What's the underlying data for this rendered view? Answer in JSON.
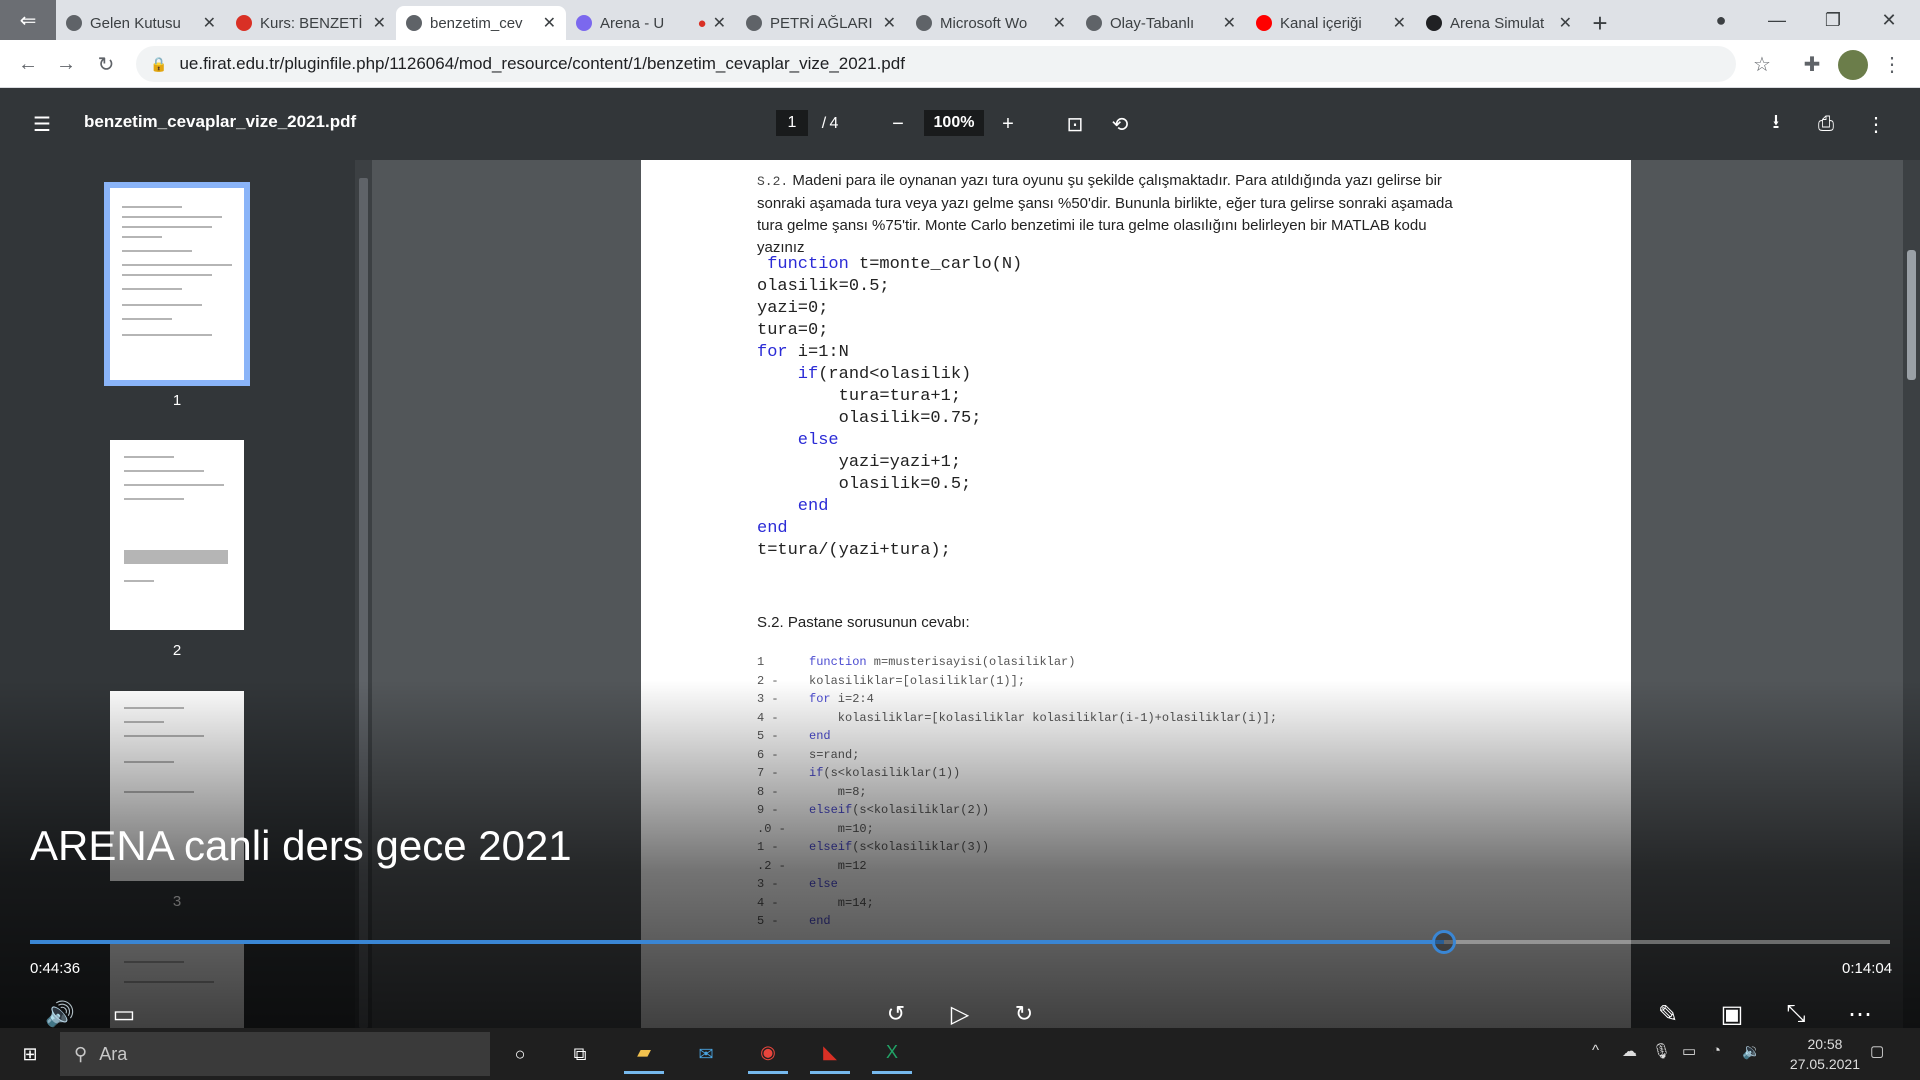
{
  "browser": {
    "tabs": [
      {
        "label": "Gelen Kutusu",
        "icon": "mail-icon",
        "color": "#5f6368"
      },
      {
        "label": "Kurs: BENZETİ",
        "icon": "moodle-icon",
        "color": "#d93025"
      },
      {
        "label": "benzetim_cev",
        "icon": "globe-icon",
        "color": "#5f6368",
        "active": true
      },
      {
        "label": "Arena - U",
        "icon": "teams-icon",
        "color": "#7b68ee",
        "recording": true
      },
      {
        "label": "PETRİ AĞLARI",
        "icon": "globe-icon",
        "color": "#5f6368"
      },
      {
        "label": "Microsoft Wo",
        "icon": "globe-icon",
        "color": "#5f6368"
      },
      {
        "label": "Olay-Tabanlı",
        "icon": "globe-icon",
        "color": "#5f6368"
      },
      {
        "label": "Kanal içeriği",
        "icon": "youtube-icon",
        "color": "#ff0000"
      },
      {
        "label": "Arena Simulat",
        "icon": "arena-icon",
        "color": "#202124"
      }
    ],
    "url": "ue.firat.edu.tr/pluginfile.php/1126064/mod_resource/content/1/benzetim_cevaplar_vize_2021.pdf"
  },
  "pdf": {
    "filename": "benzetim_cevaplar_vize_2021.pdf",
    "current_page": "1",
    "page_sep": "/",
    "total_pages": "4",
    "zoom": "100%",
    "thumbnails": [
      "1",
      "2",
      "3"
    ],
    "question": {
      "label": "S.2.",
      "lines": [
        "Madeni para ile oynanan yazı tura oyunu şu şekilde çalışmaktadır. Para atıldığında yazı gelirse bir",
        "sonraki aşamada tura veya yazı gelme şansı %50'dir. Bununla birlikte, eğer tura gelirse sonraki aşamada",
        "tura gelme şansı %75'tir. Monte Carlo benzetimi ile tura gelme olasılığını belirleyen bir MATLAB kodu",
        "yazınız"
      ]
    },
    "code1": [
      {
        "kw": " function",
        "rest": " t=monte_carlo(N)"
      },
      {
        "kw": "",
        "rest": "olasilik=0.5;"
      },
      {
        "kw": "",
        "rest": "yazi=0;"
      },
      {
        "kw": "",
        "rest": "tura=0;"
      },
      {
        "kw": "for",
        "rest": " i=1:N"
      },
      {
        "kw": "    if",
        "rest": "(rand<olasilik)"
      },
      {
        "kw": "",
        "rest": "        tura=tura+1;"
      },
      {
        "kw": "",
        "rest": "        olasilik=0.75;"
      },
      {
        "kw": "    else",
        "rest": ""
      },
      {
        "kw": "",
        "rest": "        yazi=yazi+1;"
      },
      {
        "kw": "",
        "rest": "        olasilik=0.5;"
      },
      {
        "kw": "    end",
        "rest": ""
      },
      {
        "kw": "end",
        "rest": ""
      },
      {
        "kw": "",
        "rest": "t=tura/(yazi+tura);"
      }
    ],
    "answer_heading": "S.2. Pastane sorusunun cevabı:",
    "code2_numbers": [
      "1",
      "2 -",
      "3 -",
      "4 -",
      "5 -",
      "6 -",
      "7 -",
      "8 -",
      "9 -",
      ".0 -",
      "1 -",
      ".2 -",
      "3 -",
      "4 -",
      "5 -"
    ],
    "code2": [
      {
        "kw": "function",
        "rest": " m=musterisayisi(olasiliklar)"
      },
      {
        "kw": "",
        "rest": "kolasiliklar=[olasiliklar(1)];"
      },
      {
        "kw": "for",
        "rest": " i=2:4"
      },
      {
        "kw": "",
        "rest": "    kolasiliklar=[kolasiliklar kolasiliklar(i-1)+olasiliklar(i)];"
      },
      {
        "kw": "end",
        "rest": ""
      },
      {
        "kw": "",
        "rest": "s=rand;"
      },
      {
        "kw": "if",
        "rest": "(s<kolasiliklar(1))"
      },
      {
        "kw": "",
        "rest": "    m=8;"
      },
      {
        "kw": "elseif",
        "rest": "(s<kolasiliklar(2))"
      },
      {
        "kw": "",
        "rest": "    m=10;"
      },
      {
        "kw": "elseif",
        "rest": "(s<kolasiliklar(3))"
      },
      {
        "kw": "",
        "rest": "    m=12"
      },
      {
        "kw": "else",
        "rest": ""
      },
      {
        "kw": "",
        "rest": "    m=14;"
      },
      {
        "kw": "end",
        "rest": ""
      }
    ]
  },
  "video": {
    "title": "ARENA canli ders gece 2021",
    "elapsed": "0:44:36",
    "remaining": "0:14:04",
    "progress_fraction": 0.76,
    "accent": "#3a86d4"
  },
  "taskbar": {
    "search_placeholder": "Ara",
    "time": "20:58",
    "date": "27.05.2021"
  }
}
